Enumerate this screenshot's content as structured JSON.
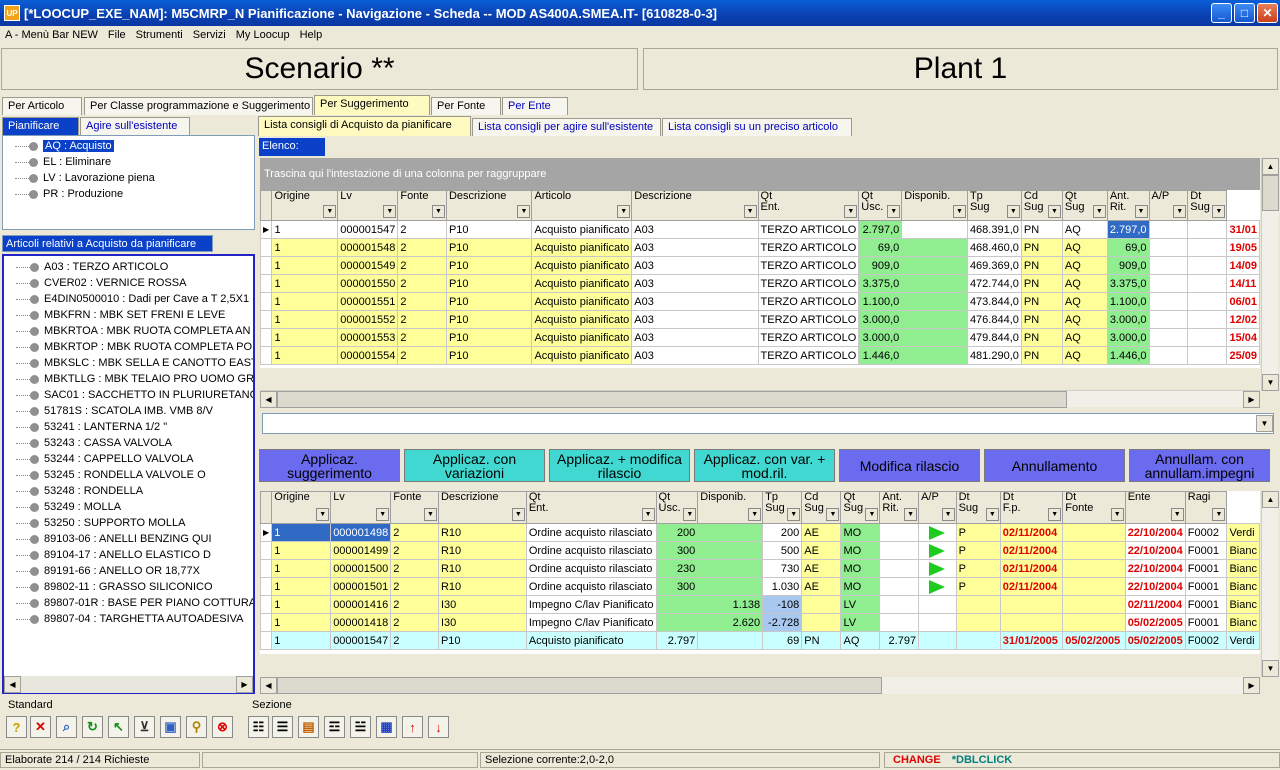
{
  "window": {
    "title": "[*LOOCUP_EXE_NAM]: M5CMRP_N Pianificazione - Navigazione - Scheda -- MOD AS400A.SMEA.IT- [610828-0-3]",
    "icon": "UP"
  },
  "menu": [
    "A - Menù Bar NEW",
    "File",
    "Strumenti",
    "Servizi",
    "My Loocup",
    "Help"
  ],
  "panels": {
    "left": "Scenario **",
    "right": "Plant 1"
  },
  "main_tabs": [
    "Per Articolo",
    "Per Classe programmazione e Suggerimento",
    "Per Suggerimento",
    "Per Fonte",
    "Per Ente"
  ],
  "left_tabs": [
    "Pianificare",
    "Agire sull'esistente"
  ],
  "sub_tabs": [
    "Lista consigli di Acquisto da pianificare",
    "Lista consigli per agire sull'esistente",
    "Lista consigli su un preciso articolo"
  ],
  "suggest_tree": [
    "AQ : Acquisto",
    "EL : Eliminare",
    "LV : Lavorazione piena",
    "PR : Produzione"
  ],
  "articles_header": "Articoli relativi a Acquisto da pianificare",
  "articles": [
    "A03 : TERZO ARTICOLO",
    "CVER02 : VERNICE ROSSA",
    "E4DIN0500010 : Dadi per Cave a T 2,5X1",
    "MBKFRN : MBK SET FRENI E LEVE",
    "MBKRTOA : MBK RUOTA COMPLETA AN",
    "MBKRTOP : MBK RUOTA COMPLETA PO",
    "MBKSLC : MBK SELLA E CANOTTO EAST",
    "MBKTLLG : MBK TELAIO PRO UOMO GRI",
    "SAC01 : SACCHETTO IN PLURIURETANC",
    "51781S : SCATOLA IMB. VMB 8/V",
    "53241 : LANTERNA 1/2 \"",
    "53243 : CASSA VALVOLA",
    "53244 : CAPPELLO VALVOLA",
    "53245 : RONDELLA VALVOLE O",
    "53248 : RONDELLA",
    "53249 : MOLLA",
    "53250 : SUPPORTO MOLLA",
    "89103-06 : ANELLI BENZING QUI",
    "89104-17 : ANELLO ELASTICO D",
    "89191-66 : ANELLO OR 18,77X",
    "89802-11 : GRASSO SILICONICO",
    "89807-01R : BASE PER PIANO COTTURA",
    "89807-04 : TARGHETTA AUTOADESIVA"
  ],
  "elenco_label": "Elenco:",
  "group_hint": "Trascina qui l'intestazione di una colonna per raggruppare",
  "grid1": {
    "headers": [
      "Origine",
      "Lv",
      "Fonte",
      "Descrizione",
      "Articolo",
      "Descrizione",
      "Qt\nEnt.",
      "Qt\nUsc.",
      "Disponib.",
      "Tp\nSug",
      "Cd\nSug",
      "Qt\nSug",
      "Ant.\nRit.",
      "A/P",
      "Dt\nSug"
    ],
    "rows": [
      [
        "1",
        "000001547",
        "2",
        "P10",
        "Acquisto pianificato",
        "A03",
        "TERZO ARTICOLO",
        "2.797,0",
        "",
        "468.391,0",
        "PN",
        "AQ",
        "2.797,0",
        "",
        "",
        "31/01"
      ],
      [
        "1",
        "000001548",
        "2",
        "P10",
        "Acquisto pianificato",
        "A03",
        "TERZO ARTICOLO",
        "69,0",
        "",
        "468.460,0",
        "PN",
        "AQ",
        "69,0",
        "",
        "",
        "19/05"
      ],
      [
        "1",
        "000001549",
        "2",
        "P10",
        "Acquisto pianificato",
        "A03",
        "TERZO ARTICOLO",
        "909,0",
        "",
        "469.369,0",
        "PN",
        "AQ",
        "909,0",
        "",
        "",
        "14/09"
      ],
      [
        "1",
        "000001550",
        "2",
        "P10",
        "Acquisto pianificato",
        "A03",
        "TERZO ARTICOLO",
        "3.375,0",
        "",
        "472.744,0",
        "PN",
        "AQ",
        "3.375,0",
        "",
        "",
        "14/11"
      ],
      [
        "1",
        "000001551",
        "2",
        "P10",
        "Acquisto pianificato",
        "A03",
        "TERZO ARTICOLO",
        "1.100,0",
        "",
        "473.844,0",
        "PN",
        "AQ",
        "1.100,0",
        "",
        "",
        "06/01"
      ],
      [
        "1",
        "000001552",
        "2",
        "P10",
        "Acquisto pianificato",
        "A03",
        "TERZO ARTICOLO",
        "3.000,0",
        "",
        "476.844,0",
        "PN",
        "AQ",
        "3.000,0",
        "",
        "",
        "12/02"
      ],
      [
        "1",
        "000001553",
        "2",
        "P10",
        "Acquisto pianificato",
        "A03",
        "TERZO ARTICOLO",
        "3.000,0",
        "",
        "479.844,0",
        "PN",
        "AQ",
        "3.000,0",
        "",
        "",
        "15/04"
      ],
      [
        "1",
        "000001554",
        "2",
        "P10",
        "Acquisto pianificato",
        "A03",
        "TERZO ARTICOLO",
        "1.446,0",
        "",
        "481.290,0",
        "PN",
        "AQ",
        "1.446,0",
        "",
        "",
        "25/09"
      ]
    ]
  },
  "actions": [
    "Applicaz. suggerimento",
    "Applicaz. con variazioni",
    "Applicaz. + modifica rilascio",
    "Applicaz. con var. + mod.ril.",
    "Modifica rilascio",
    "Annullamento",
    "Annullam. con annullam.impegni"
  ],
  "grid2": {
    "headers": [
      "Origine",
      "Lv",
      "Fonte",
      "Descrizione",
      "Qt\nEnt.",
      "Qt\nUsc.",
      "Disponib.",
      "Tp\nSug",
      "Cd\nSug",
      "Qt\nSug",
      "Ant.\nRit.",
      "A/P",
      "Dt\nSug",
      "Dt\nF.p.",
      "Dt\nFonte",
      "Ente",
      "Ragi"
    ],
    "rows": [
      [
        "1",
        "000001498",
        "2",
        "R10",
        "Ordine acquisto rilasciato",
        "200",
        "",
        "200",
        "AE",
        "MO",
        "",
        "flag",
        "P",
        "02/11/2004",
        "",
        "22/10/2004",
        "F0002",
        "Verdi"
      ],
      [
        "1",
        "000001499",
        "2",
        "R10",
        "Ordine acquisto rilasciato",
        "300",
        "",
        "500",
        "AE",
        "MO",
        "",
        "flag",
        "P",
        "02/11/2004",
        "",
        "22/10/2004",
        "F0001",
        "Bianc"
      ],
      [
        "1",
        "000001500",
        "2",
        "R10",
        "Ordine acquisto rilasciato",
        "230",
        "",
        "730",
        "AE",
        "MO",
        "",
        "flag",
        "P",
        "02/11/2004",
        "",
        "22/10/2004",
        "F0001",
        "Bianc"
      ],
      [
        "1",
        "000001501",
        "2",
        "R10",
        "Ordine acquisto rilasciato",
        "300",
        "",
        "1.030",
        "AE",
        "MO",
        "",
        "flag",
        "P",
        "02/11/2004",
        "",
        "22/10/2004",
        "F0001",
        "Bianc"
      ],
      [
        "1",
        "000001416",
        "2",
        "I30",
        "Impegno C/lav Pianificato",
        "",
        "1.138",
        "-108",
        "",
        "LV",
        "",
        "",
        "",
        "",
        "",
        "02/11/2004",
        "F0001",
        "Bianc"
      ],
      [
        "1",
        "000001418",
        "2",
        "I30",
        "Impegno C/lav Pianificato",
        "",
        "2.620",
        "-2.728",
        "",
        "LV",
        "",
        "",
        "",
        "",
        "",
        "05/02/2005",
        "F0001",
        "Bianc"
      ],
      [
        "1",
        "000001547",
        "2",
        "P10",
        "Acquisto pianificato",
        "2.797",
        "",
        "69",
        "PN",
        "AQ",
        "2.797",
        "",
        "",
        "31/01/2005",
        "05/02/2005",
        "05/02/2005",
        "F0002",
        "Verdi"
      ]
    ]
  },
  "toolbar": {
    "standard_label": "Standard",
    "sezione_label": "Sezione"
  },
  "status": {
    "left": "Elaborate 214 / 214 Richieste",
    "selection": "Selezione corrente:2,0-2,0",
    "change": "CHANGE",
    "dbl": "*DBLCLICK"
  }
}
